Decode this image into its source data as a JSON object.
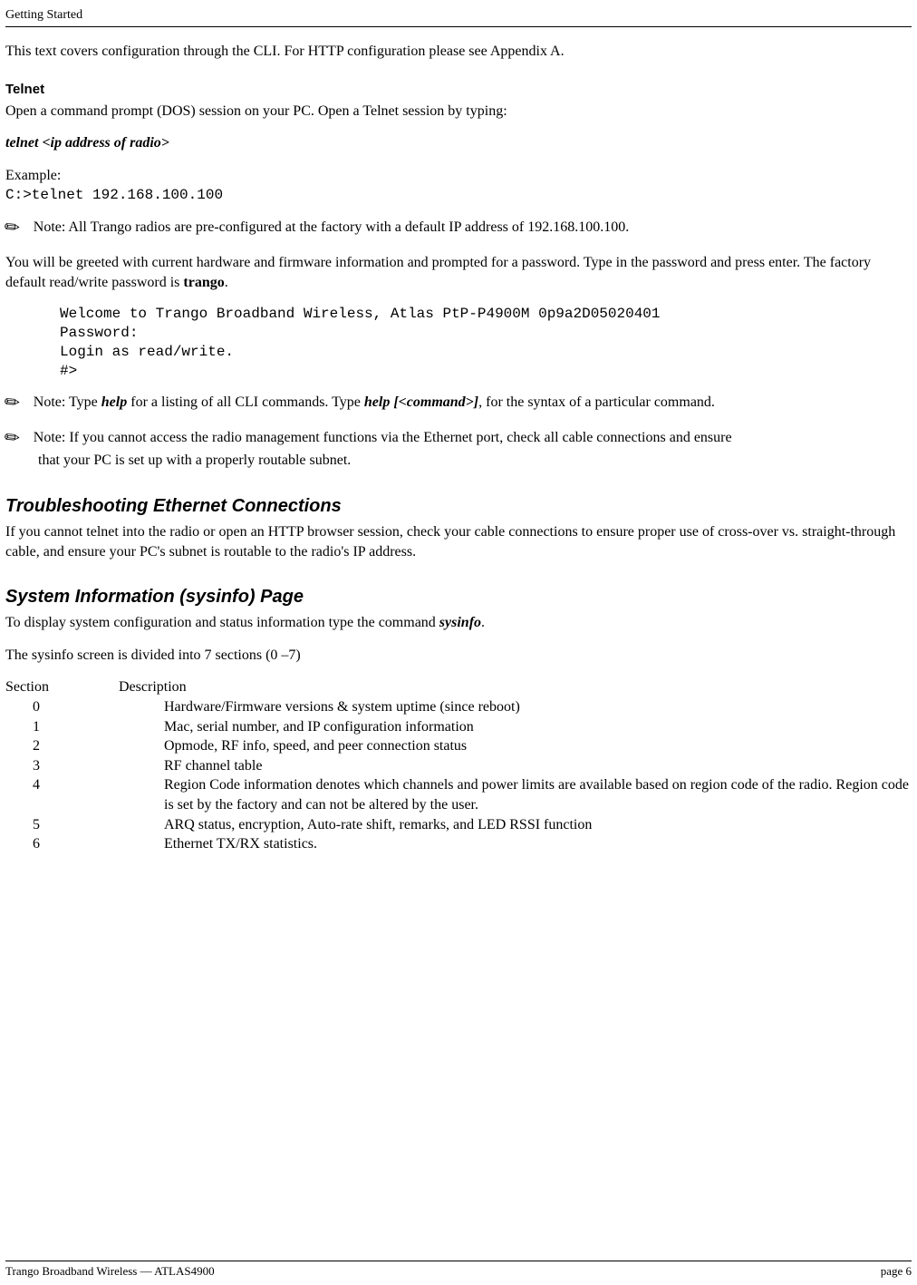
{
  "header": {
    "title": "Getting Started"
  },
  "intro": {
    "line1": "This text covers configuration through the CLI.  For HTTP configuration please see Appendix A."
  },
  "telnet": {
    "heading": "Telnet",
    "line1": "Open a command prompt (DOS) session on your PC.  Open a Telnet session by typing:",
    "cmd_label": "telnet <ip address of radio>",
    "example_label": "Example:",
    "example_cmd": "C:>telnet 192.168.100.100",
    "note1_prefix": "Note:  All Trango radios are pre-configured at the factory with a default IP address of 192.168.100.100.",
    "para2a": "You will be greeted with current hardware and firmware information and prompted for a password.  Type in the password and press enter.  The factory default read/write password is ",
    "para2b": "trango",
    "para2c": ".",
    "code1": "Welcome to Trango Broadband Wireless, Atlas PtP-P4900M 0p9a2D05020401",
    "code2": "Password:",
    "code3": "Login as read/write.",
    "code4": "#>",
    "note2_a": "Note:  Type ",
    "note2_b": "help",
    "note2_c": " for a listing of all CLI commands.  Type ",
    "note2_d": "help [<command>]",
    "note2_e": ", for the syntax of a particular command.",
    "note3_a": "Note:  If you cannot access the radio management functions via the Ethernet port, check all cable connections and ensure",
    "note3_b": "that your PC is set up with a properly routable subnet."
  },
  "troubleshoot": {
    "heading": "Troubleshooting Ethernet Connections",
    "body": "If you cannot telnet into the radio or open an HTTP browser session, check your cable connections to ensure proper use of cross-over vs. straight-through cable, and ensure your PC's subnet is routable to the radio's IP address."
  },
  "sysinfo": {
    "heading": "System Information (sysinfo) Page",
    "intro_a": "To display system configuration and status information type the command ",
    "intro_b": "sysinfo",
    "intro_c": ".",
    "divided": "The sysinfo screen is divided into 7 sections (0 –7)",
    "header_col1": "Section",
    "header_col2": "Description",
    "rows": [
      {
        "num": "0",
        "desc": "Hardware/Firmware versions & system uptime (since reboot)"
      },
      {
        "num": "1",
        "desc": "Mac, serial number, and IP configuration information"
      },
      {
        "num": "2",
        "desc": "Opmode, RF info, speed, and peer connection status"
      },
      {
        "num": "3",
        "desc": "RF channel table"
      },
      {
        "num": "4",
        "desc": "Region Code information denotes which channels and power limits are available based on region code of the radio.  Region code is set by the factory and can not be altered by the user."
      },
      {
        "num": "5",
        "desc": "ARQ status, encryption, Auto-rate shift, remarks, and LED RSSI function"
      },
      {
        "num": "6",
        "desc": "Ethernet TX/RX statistics."
      }
    ]
  },
  "footer": {
    "left": "Trango Broadband Wireless — ATLAS4900",
    "right": "page 6"
  }
}
